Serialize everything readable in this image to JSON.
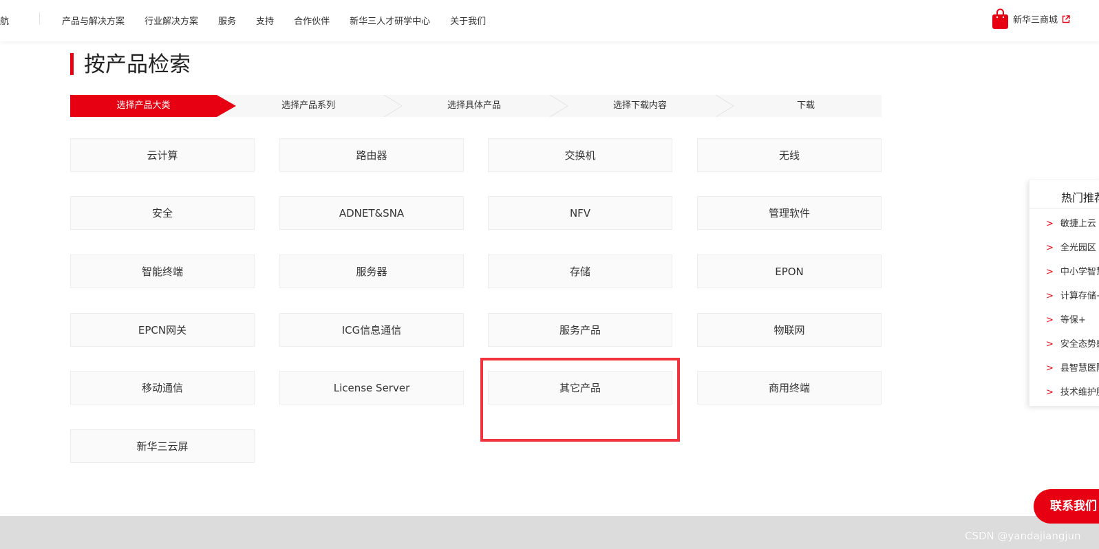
{
  "nav": {
    "cut_label": "导航",
    "items": [
      "产品与解决方案",
      "行业解决方案",
      "服务",
      "支持",
      "合作伙伴",
      "新华三人才研学中心",
      "关于我们"
    ],
    "mall_label": "新华三商城",
    "mall_icon": "shopping-bag-icon",
    "external_icon": "external-link-icon"
  },
  "page_title": "按产品检索",
  "steps": [
    "选择产品大类",
    "选择产品系列",
    "选择具体产品",
    "选择下载内容",
    "下载"
  ],
  "active_step": 0,
  "products": [
    "云计算",
    "路由器",
    "交换机",
    "无线",
    "安全",
    "ADNET&SNA",
    "NFV",
    "管理软件",
    "智能终端",
    "服务器",
    "存储",
    "EPON",
    "EPCN网关",
    "ICG信息通信",
    "服务产品",
    "物联网",
    "移动通信",
    "License Server",
    "其它产品",
    "商用终端",
    "新华三云屏"
  ],
  "highlighted_product": "其它产品",
  "side_panel": {
    "title": "热门推荐",
    "items": [
      "敏捷上云",
      "全光园区",
      "中小学智慧",
      "计算存储+",
      "等保+",
      "安全态势感知",
      "县智慧医院",
      "技术维护服务"
    ]
  },
  "contact_label": "联系我们",
  "watermark": "CSDN @yandajiangjun",
  "colors": {
    "accent": "#e60012",
    "highlight_box": "#f0333d",
    "footer": "#dcdcdc"
  }
}
